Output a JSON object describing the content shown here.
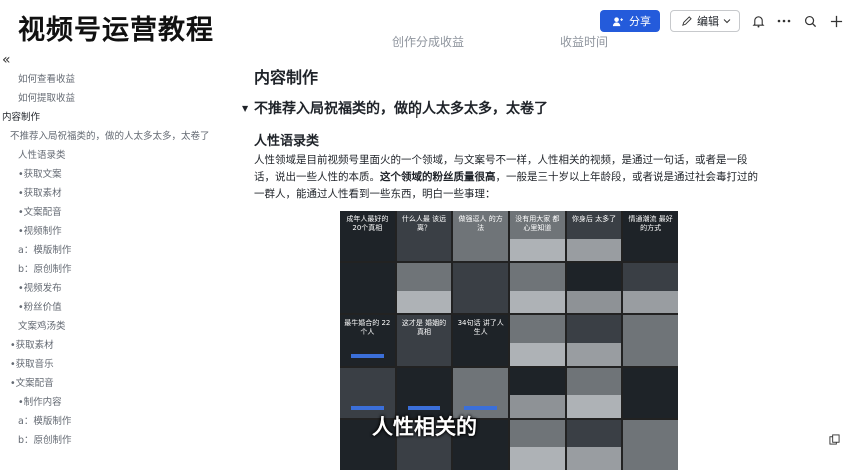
{
  "header": {
    "big_title": "视频号运营教程",
    "share_label": "分享",
    "edit_label": "编辑",
    "faded_left": "创作分成收益",
    "faded_right": "收益时间",
    "icons": [
      "user-plus-icon",
      "edit-icon",
      "chevron-down-icon",
      "bell-icon",
      "more-icon",
      "search-icon",
      "plus-icon"
    ]
  },
  "sidebar": {
    "collapse_icon": "«",
    "items": [
      {
        "label": "如何查看收益"
      },
      {
        "label": "如何提取收益"
      },
      {
        "label": "内容制作"
      },
      {
        "label": "不推荐入局祝福类的，做的人太多太多，太卷了"
      },
      {
        "label": "人性语录类"
      },
      {
        "label": "•获取文案"
      },
      {
        "label": "•获取素材"
      },
      {
        "label": "•文案配音"
      },
      {
        "label": "•视频制作"
      },
      {
        "label": "a：模版制作"
      },
      {
        "label": "b：原创制作"
      },
      {
        "label": "•视频发布"
      },
      {
        "label": "•粉丝价值"
      },
      {
        "label": "文案鸡汤类"
      },
      {
        "label": "•获取素材"
      },
      {
        "label": "•获取音乐"
      },
      {
        "label": "•文案配音"
      },
      {
        "label": "•制作内容"
      },
      {
        "label": "a：模版制作"
      },
      {
        "label": "b：原创制作"
      }
    ]
  },
  "main": {
    "h1": "内容制作",
    "h2": "不推荐入局祝福类的，做的人太多太多，太卷了",
    "h3": "人性语录类",
    "para_1": "人性领域是目前视频号里面火的一个领域，与文案号不一样，人性相关的视频，是通过一句话，或者是一段话，说出一些人性的本质。",
    "para_bold": "这个领域的粉丝质量很高",
    "para_2": "，一般是三十岁以上年龄段，或者说是通过社会毒打过的一群人，能通过人性看到一些东西，明白一些事理：",
    "collage_overlay": "人性相关的",
    "tiles": [
      "成年人最好的\n20个真相",
      "什么人最\n该远离？",
      "做强逗人\n的方法",
      "没有用大家\n都心里知道",
      "你身后\n太多了",
      "情通潮流\n最好的方式",
      "",
      "",
      "",
      "",
      "",
      "",
      "最牛婚合的\n22个人",
      "这才是\n婚姻的真相",
      "34句话\n讲了人生人",
      "",
      "",
      "",
      "",
      "",
      "",
      "",
      "",
      "",
      "",
      "",
      "",
      "",
      "",
      ""
    ]
  },
  "colors": {
    "primary": "#245bdb"
  }
}
